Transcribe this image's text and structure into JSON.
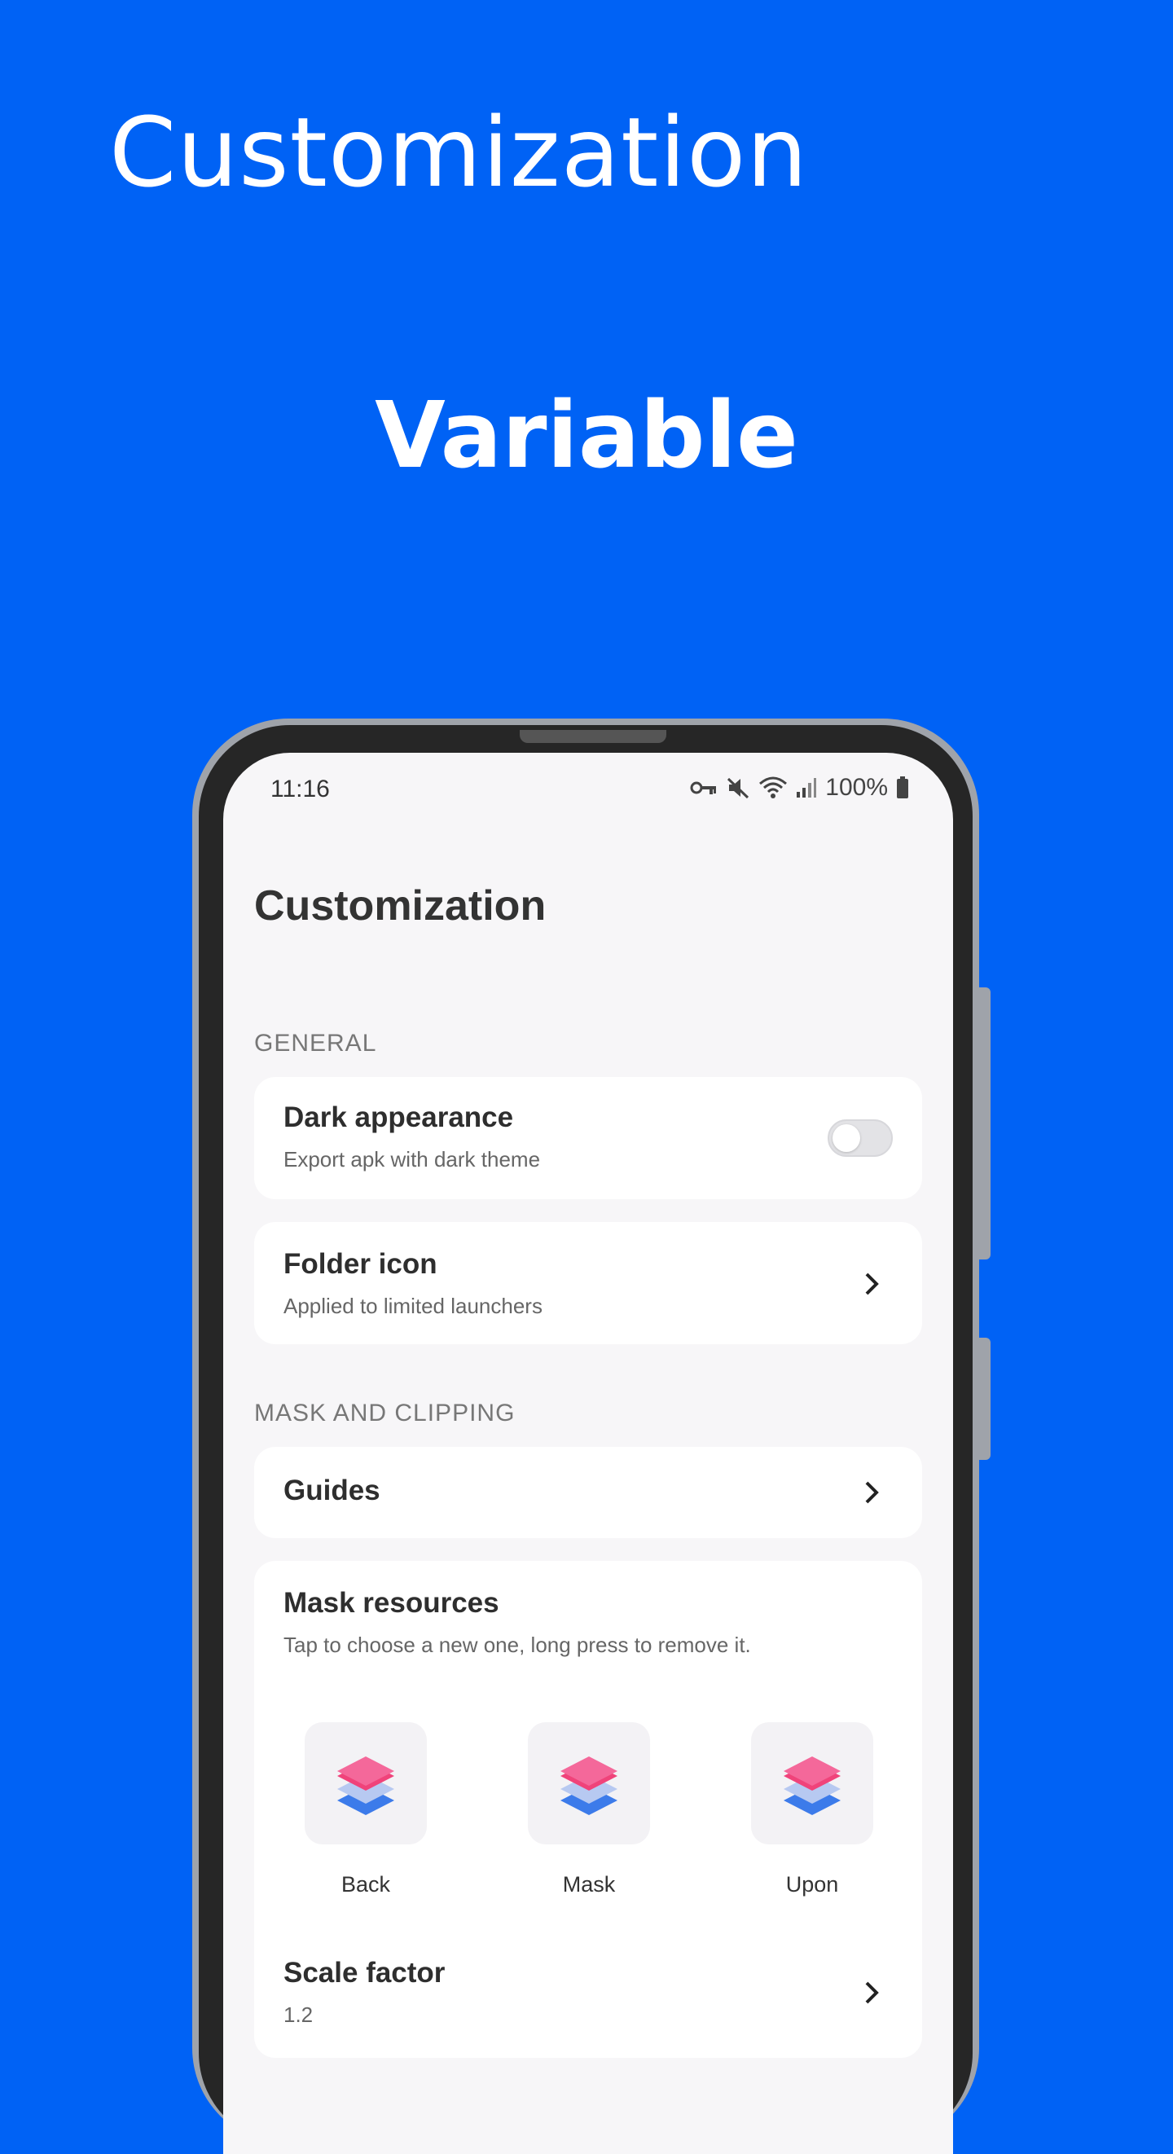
{
  "hero": {
    "title": "Customization",
    "subtitle": "Variable"
  },
  "status_bar": {
    "time": "11:16",
    "battery": "100%"
  },
  "screen": {
    "title": "Customization",
    "sections": {
      "general": {
        "header": "GENERAL"
      },
      "mask": {
        "header": "MASK AND CLIPPING"
      }
    },
    "dark_appearance": {
      "title": "Dark appearance",
      "subtitle": "Export apk with dark theme",
      "enabled": false
    },
    "folder_icon": {
      "title": "Folder icon",
      "subtitle": "Applied to limited launchers"
    },
    "guides": {
      "title": "Guides"
    },
    "mask_resources": {
      "title": "Mask resources",
      "subtitle": "Tap to choose a new one, long press to remove it.",
      "items": [
        {
          "label": "Back"
        },
        {
          "label": "Mask"
        },
        {
          "label": "Upon"
        }
      ]
    },
    "scale_factor": {
      "title": "Scale factor",
      "value": "1.2"
    }
  },
  "colors": {
    "background": "#0062F5",
    "screen": "#F7F6F8",
    "card": "#FFFFFF",
    "icon_pink": "#F0437A",
    "icon_blue": "#3C7BEA"
  }
}
